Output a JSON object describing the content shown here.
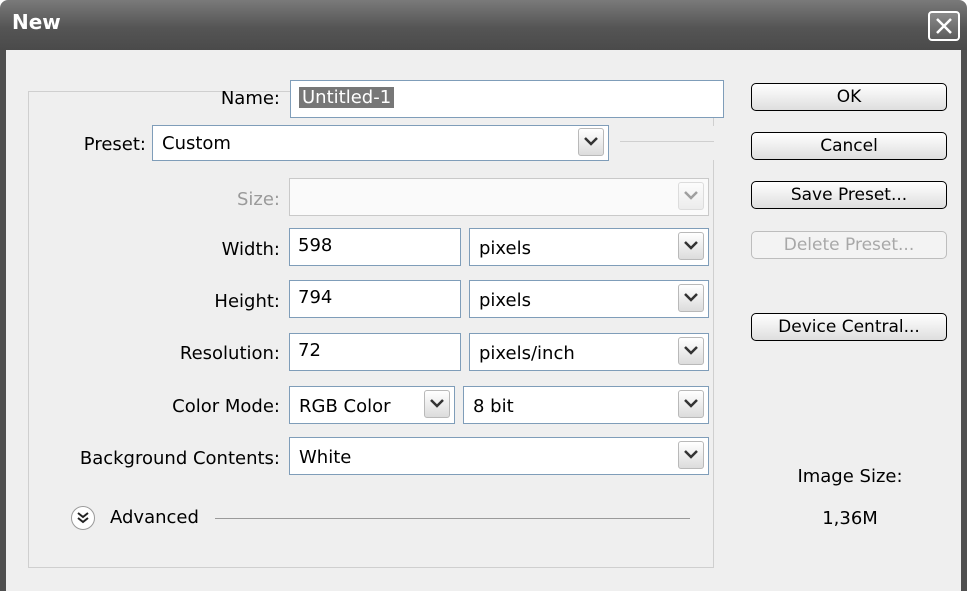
{
  "dialog": {
    "title": "New"
  },
  "form": {
    "name_label": "Name:",
    "name_value": "Untitled-1",
    "preset_label": "Preset:",
    "preset_value": "Custom",
    "size_label": "Size:",
    "size_value": "",
    "width_label": "Width:",
    "width_value": "598",
    "width_unit": "pixels",
    "height_label": "Height:",
    "height_value": "794",
    "height_unit": "pixels",
    "resolution_label": "Resolution:",
    "resolution_value": "72",
    "resolution_unit": "pixels/inch",
    "color_mode_label": "Color Mode:",
    "color_mode_value": "RGB Color",
    "bit_depth_value": "8 bit",
    "background_label": "Background Contents:",
    "background_value": "White",
    "advanced_label": "Advanced"
  },
  "buttons": {
    "ok": "OK",
    "cancel": "Cancel",
    "save_preset": "Save Preset...",
    "delete_preset": "Delete Preset...",
    "device_central": "Device Central..."
  },
  "image_size": {
    "label": "Image Size:",
    "value": "1,36M"
  },
  "colors": {
    "titlebar": "#555555",
    "dialog_bg": "#efefef",
    "field_border": "#7f9db9",
    "selection_bg": "#777777"
  }
}
